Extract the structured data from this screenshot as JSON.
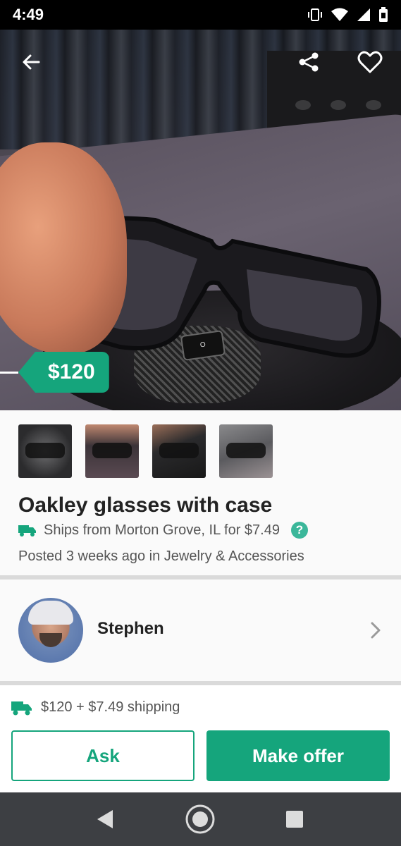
{
  "status_bar": {
    "time": "4:49",
    "icons": [
      "vibrate-icon",
      "wifi-icon",
      "signal-icon",
      "battery-icon"
    ]
  },
  "header": {
    "back_icon": "arrow-left-icon",
    "share_icon": "share-icon",
    "favorite_icon": "heart-outline-icon"
  },
  "listing": {
    "price_tag": "$120",
    "thumbnails_count": 4,
    "title": "Oakley glasses with case",
    "shipping": "Ships from Morton Grove, IL for $7.49",
    "help_badge": "?",
    "posted": "Posted 3 weeks ago in Jewelry & Accessories"
  },
  "seller": {
    "name": "Stephen"
  },
  "footer": {
    "total": "$120 + $7.49 shipping",
    "ask_label": "Ask",
    "offer_label": "Make offer"
  },
  "colors": {
    "accent": "#15a57c",
    "help": "#3bb79a",
    "nav_bar": "#3d3f43"
  }
}
